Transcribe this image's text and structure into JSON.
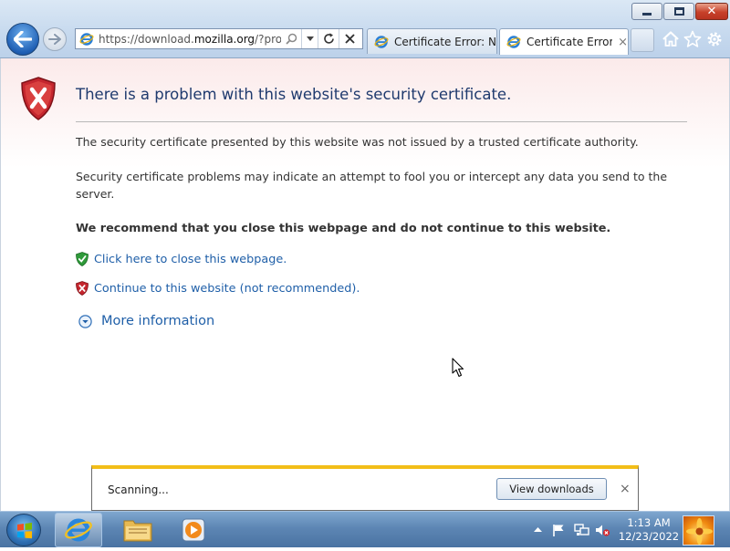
{
  "browser": {
    "address_url_prefix": "https://download.",
    "address_url_domain": "mozilla.org",
    "address_url_suffix": "/?product=",
    "tabs": [
      {
        "title": "Certificate Error: N..."
      },
      {
        "title": "Certificate Error...",
        "active": true
      }
    ],
    "tab_close_label": "×"
  },
  "page": {
    "title": "There is a problem with this website's security certificate.",
    "paragraph_1": "The security certificate presented by this website was not issued by a trusted certificate authority.",
    "paragraph_2": "Security certificate problems may indicate an attempt to fool you or intercept any data you send to the server.",
    "recommendation": "We recommend that you close this webpage and do not continue to this website.",
    "close_link": "Click here to close this webpage.",
    "continue_link": "Continue to this website (not recommended).",
    "more_info": "More information"
  },
  "download_bar": {
    "status": "Scanning...",
    "button_label": "View downloads",
    "close_label": "×"
  },
  "taskbar": {
    "time": "1:13 AM",
    "date": "12/23/2022"
  },
  "colors": {
    "link": "#1f5fa8",
    "title": "#1f3a6e",
    "danger_shield": "#c4262e",
    "safe_shield": "#2f9a3a",
    "download_accent": "#f2be18"
  }
}
